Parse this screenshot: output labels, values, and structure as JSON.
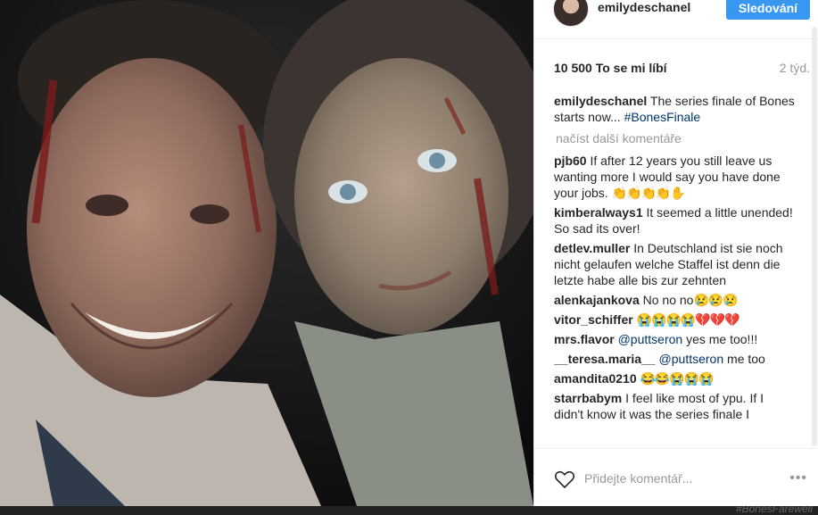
{
  "post": {
    "image_alt": "Selfie of two people with theatrical wound makeup"
  },
  "header": {
    "username": "emilydeschanel",
    "follow_label": "Sledování"
  },
  "meta": {
    "likes": "10 500 To se mi líbí",
    "time": "2 týd."
  },
  "caption": {
    "user": "emilydeschanel",
    "text": "The series finale of Bones starts now...",
    "hashtag": "#BonesFinale"
  },
  "load_more": "načíst další komentáře",
  "comments": [
    {
      "user": "pjb60",
      "text": "If after 12 years you still leave us wanting more I would say you have done your jobs.",
      "emoji": "👏👏👏👏✋"
    },
    {
      "user": "kimberalways1",
      "text": "It seemed a little unended! So sad its over!"
    },
    {
      "user": "detlev.muller",
      "text": "In Deutschland ist sie noch nicht gelaufen welche Staffel ist denn die letzte habe alle bis zur zehnten"
    },
    {
      "user": "alenkajankova",
      "text": "No no no",
      "emoji": "😢😢😢"
    },
    {
      "user": "vitor_schiffer",
      "text": "",
      "emoji": "😭😭😭😭💔💔💔"
    },
    {
      "user": "mrs.flavor",
      "mention": "@puttseron",
      "text": "yes me too!!!"
    },
    {
      "user": "__teresa.maria__",
      "mention": "@puttseron",
      "text": "me too"
    },
    {
      "user": "amandita0210",
      "text": "",
      "emoji": "😂😂😭😭😭"
    },
    {
      "user": "starrbabym",
      "text": "I feel like most of ypu. If I didn't know it was the series finale I"
    }
  ],
  "footer": {
    "comment_placeholder": "Přidejte komentář...",
    "options": "•••"
  },
  "colors": {
    "accent": "#3897f0",
    "link": "#003569",
    "muted": "#999999"
  },
  "icons": [
    "heart-icon",
    "options-icon"
  ],
  "background_text": "#BonesFarewell"
}
